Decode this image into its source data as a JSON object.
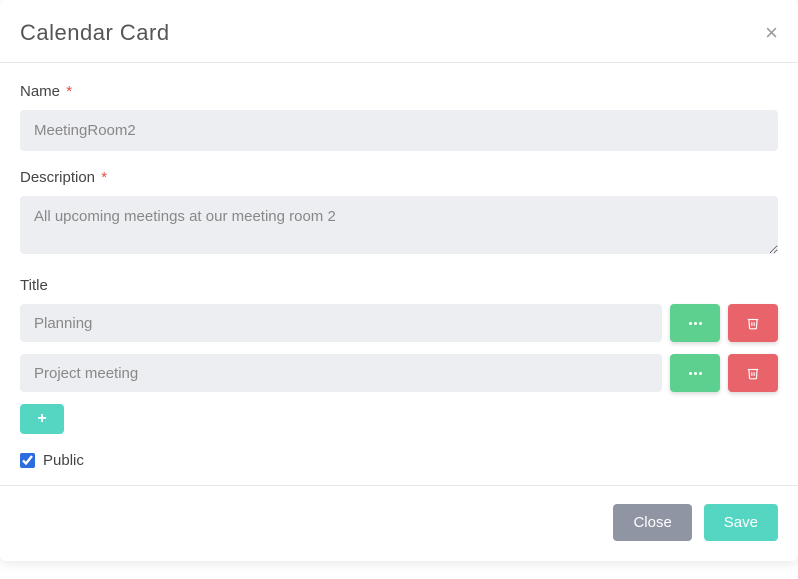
{
  "header": {
    "title": "Calendar Card"
  },
  "form": {
    "name": {
      "label": "Name",
      "value": "MeetingRoom2"
    },
    "description": {
      "label": "Description",
      "value": "All upcoming meetings at our meeting room 2"
    },
    "title": {
      "label": "Title"
    },
    "titles": [
      {
        "value": "Planning"
      },
      {
        "value": "Project meeting"
      }
    ],
    "public": {
      "label": "Public",
      "checked": true
    }
  },
  "footer": {
    "close": "Close",
    "save": "Save"
  }
}
